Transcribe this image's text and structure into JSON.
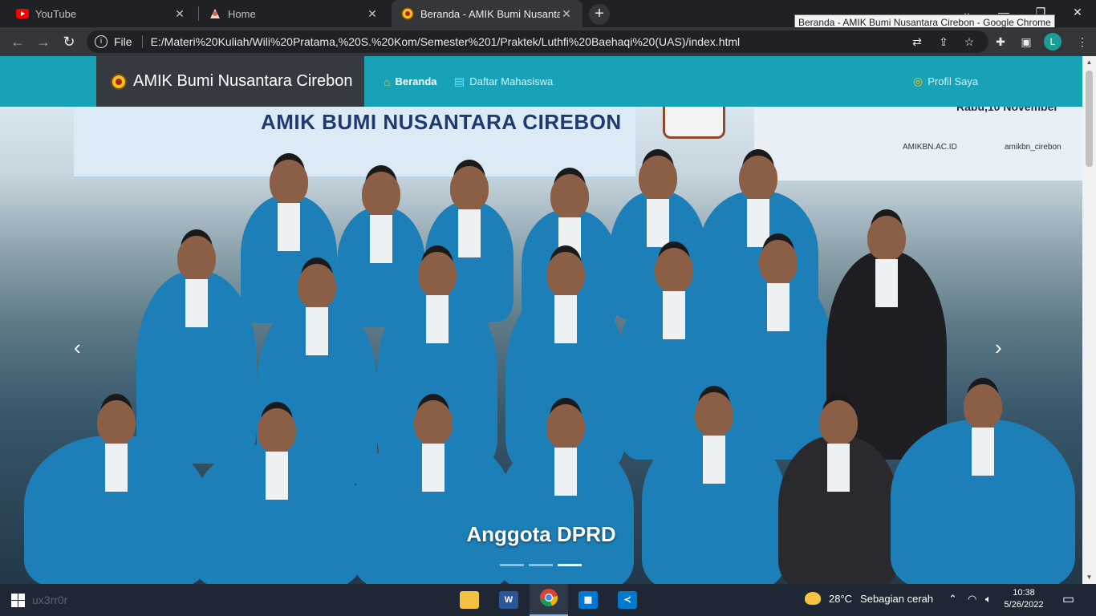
{
  "browser": {
    "tabs": [
      {
        "title": "YouTube",
        "icon": "youtube-icon"
      },
      {
        "title": "Home",
        "icon": "home-favicon"
      },
      {
        "title": "Beranda - AMIK Bumi Nusantara Cirebon",
        "icon": "amik-favicon"
      }
    ],
    "tooltip": "Beranda - AMIK Bumi Nusantara Cirebon - Google Chrome",
    "address": {
      "scheme_label": "File",
      "url": "E:/Materi%20Kuliah/Wili%20Pratama,%20S.%20Kom/Semester%201/Praktek/Luthfi%20Baehaqi%20(UAS)/index.html"
    },
    "profile_initial": "L"
  },
  "site": {
    "brand": "AMIK Bumi Nusantara Cirebon",
    "nav": [
      {
        "label": "Beranda",
        "icon": "home-icon",
        "active": true
      },
      {
        "label": "Daftar Mahasiswa",
        "icon": "id-card-icon",
        "active": false
      }
    ],
    "profile_link": "Profil Saya",
    "carousel": {
      "caption": "Anggota DPRD",
      "slide_count": 3,
      "active_index": 2,
      "photo": {
        "banner_text": "AMIK BUMI NUSANTARA CIREBON",
        "date_text": "Rabu,10 November",
        "web_text": "AMIKBN.AC.ID",
        "ig_text": "amikbn_cirebon"
      }
    }
  },
  "taskbar": {
    "search_ghost": "ux3rr0r",
    "weather": {
      "temp": "28°C",
      "desc": "Sebagian cerah"
    },
    "time": "10:38",
    "date": "5/26/2022"
  },
  "colors": {
    "accent": "#17a2b8",
    "brand_bg": "#343a40",
    "icon_yellow": "#ffc107"
  }
}
